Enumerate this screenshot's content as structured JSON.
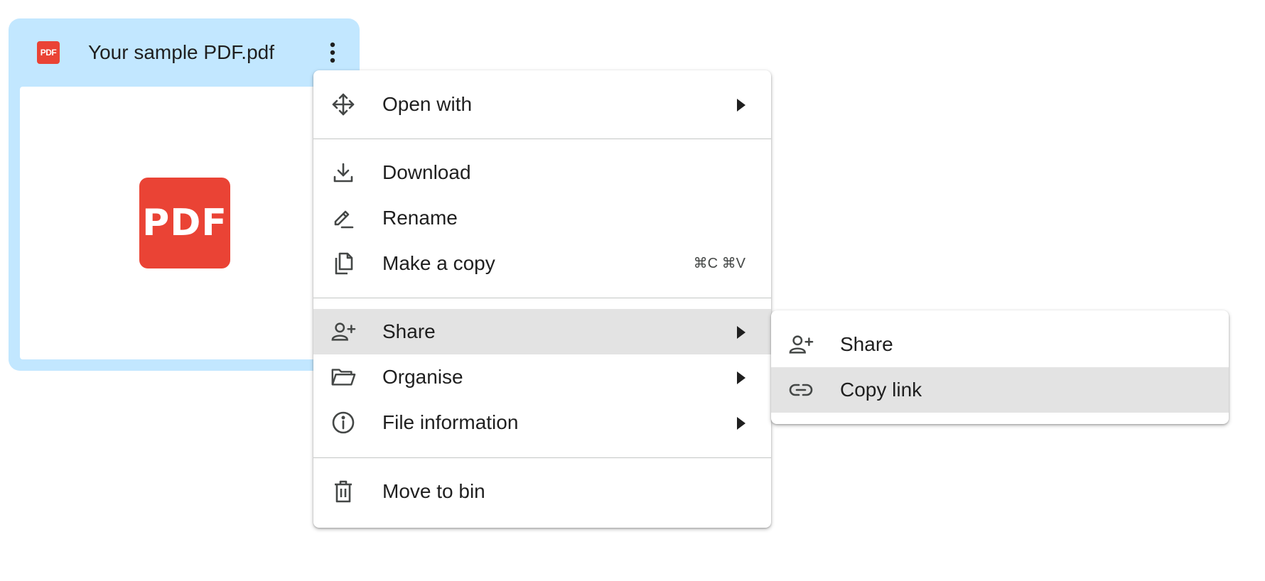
{
  "card": {
    "file_icon_label": "PDF",
    "file_name": "Your sample PDF.pdf",
    "preview_label": "PDF"
  },
  "menu": {
    "items": [
      {
        "label": "Open with",
        "icon": "open-with-icon",
        "submenu": true
      },
      {
        "label": "Download",
        "icon": "download-icon"
      },
      {
        "label": "Rename",
        "icon": "rename-pencil-icon"
      },
      {
        "label": "Make a copy",
        "icon": "copy-icon",
        "shortcut": "⌘C ⌘V"
      },
      {
        "label": "Share",
        "icon": "person-add-icon",
        "submenu": true,
        "highlighted": true
      },
      {
        "label": "Organise",
        "icon": "folder-open-icon",
        "submenu": true
      },
      {
        "label": "File information",
        "icon": "info-icon",
        "submenu": true
      },
      {
        "label": "Move to bin",
        "icon": "trash-icon"
      }
    ]
  },
  "submenu": {
    "items": [
      {
        "label": "Share",
        "icon": "person-add-icon"
      },
      {
        "label": "Copy link",
        "icon": "link-icon",
        "highlighted": true
      }
    ]
  },
  "colors": {
    "card_bg": "#c2e7ff",
    "pdf_red": "#ea4335",
    "highlight": "#e3e3e3",
    "icon": "#444746"
  }
}
